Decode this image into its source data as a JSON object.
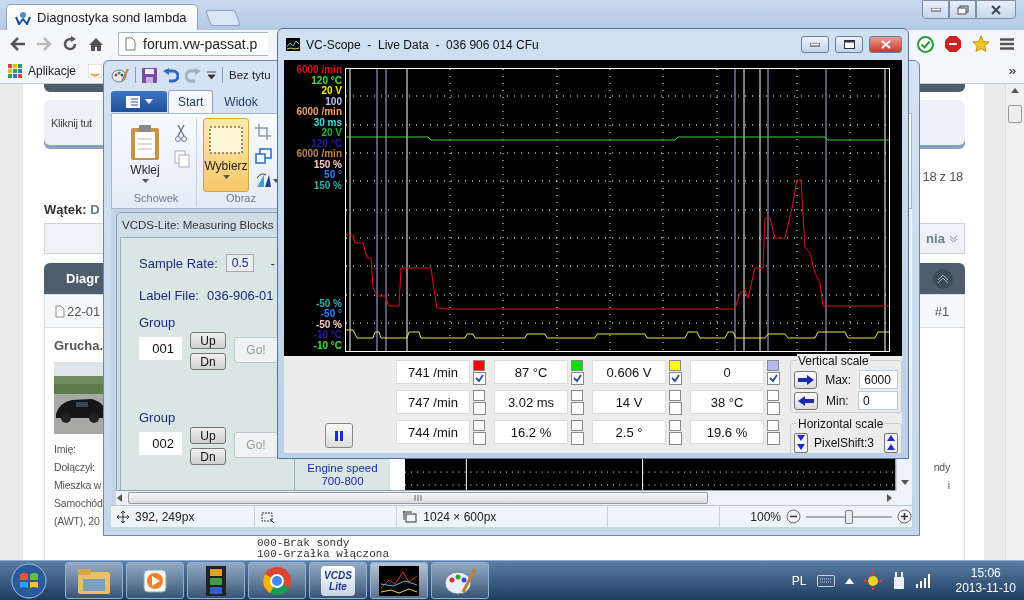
{
  "browser": {
    "tab_title": "Diagnostyka sond lambda",
    "url": "forum.vw-passat.p",
    "bookmarks": [
      "Aplikacje"
    ],
    "bookmarks_more": "»"
  },
  "forum": {
    "notice": "Kliknij tut",
    "page_count": "18 z 18",
    "thread_label": "Wątek:",
    "thread_title": "D",
    "tools_menu": "nia",
    "post_title": "Diagr",
    "post_date": "22-01",
    "post_number": "#1",
    "author": "Grucha.",
    "profile_fields": [
      "Imię:",
      "Dołączył:",
      "Mieszka w",
      "Samochód",
      "(AWT), 20"
    ],
    "post_text": [
      "ndy",
      "i"
    ],
    "post_lines": [
      "000-Brak sondy",
      "100-Grzałka włączona"
    ]
  },
  "paint": {
    "title": "Bez tytu",
    "tabs": [
      {
        "label": "Start",
        "selected": true
      },
      {
        "label": "Widok",
        "selected": false
      }
    ],
    "tools": [
      {
        "label": "Wklej",
        "selected": false
      },
      {
        "label": "Wybierz",
        "selected": true
      }
    ],
    "groups": [
      "Schowek",
      "Obraz"
    ],
    "status": {
      "cursor": "392, 249px",
      "size": "1024 × 600px",
      "zoom": "100%"
    },
    "zoom_slider": {
      "level": 0.5
    },
    "image": {
      "title": "VCDS-Lite: Measuring Blocks",
      "sample_rate_label": "Sample Rate:",
      "sample_rate": "0.5",
      "separator": "-",
      "label_file_label": "Label File:",
      "label_file": "036-906-01",
      "groups": [
        {
          "label": "Group",
          "value": "001",
          "up": "Up",
          "down": "Dn",
          "go": "Go!"
        },
        {
          "label": "Group",
          "value": "002",
          "up": "Up",
          "down": "Dn",
          "go": "Go!"
        }
      ],
      "field_name": "Engine speed",
      "field_range": "700-800"
    }
  },
  "scope": {
    "title": "VC-Scope  -  Live Data  -  036 906 014 CFu",
    "axis_top": [
      {
        "text": "6000 /min",
        "color": "#e01010"
      },
      {
        "text": "120 °C",
        "color": "#40e040"
      },
      {
        "text": "20 V",
        "color": "#f0f000"
      },
      {
        "text": "100",
        "color": "#c0c0f8"
      },
      {
        "text": "6000 /min",
        "color": "#f0a060"
      },
      {
        "text": "30 ms",
        "color": "#40e0e0"
      },
      {
        "text": "20 V",
        "color": "#30b030"
      },
      {
        "text": "120 °C",
        "color": "#2020a0"
      },
      {
        "text": "6000 /min",
        "color": "#c08048"
      },
      {
        "text": "150 %",
        "color": "#ffc8c8"
      },
      {
        "text": "50 °",
        "color": "#3080ff"
      },
      {
        "text": "150 %",
        "color": "#30b0b0"
      }
    ],
    "axis_bottom": [
      {
        "text": "-50 %",
        "color": "#30b0b0"
      },
      {
        "text": "-50 °",
        "color": "#3080ff"
      },
      {
        "text": "-50 %",
        "color": "#ffc8c8"
      },
      {
        "text": "-10 °C",
        "color": "#2020a0"
      },
      {
        "text": "-10 °C",
        "color": "#40e040"
      }
    ],
    "rows": [
      {
        "cells": [
          {
            "value": "741 /min",
            "color": "#ff0000",
            "checked": true
          },
          {
            "value": "87 °C",
            "color": "#00e000",
            "checked": true
          },
          {
            "value": "0.606 V",
            "color": "#ffff00",
            "checked": true
          },
          {
            "value": "0",
            "color": "#b8b8f0",
            "checked": true
          }
        ]
      },
      {
        "cells": [
          {
            "value": "747 /min",
            "checked": false
          },
          {
            "value": "3.02 ms",
            "checked": false
          },
          {
            "value": "14 V",
            "checked": false
          },
          {
            "value": "38 °C",
            "checked": false
          }
        ]
      },
      {
        "cells": [
          {
            "value": "744 /min",
            "checked": false
          },
          {
            "value": "16.2 %",
            "checked": false
          },
          {
            "value": "2.5 °",
            "checked": false
          },
          {
            "value": "19.6 %",
            "checked": false
          }
        ]
      }
    ],
    "vertical_scale": {
      "title": "Vertical scale",
      "max_label": "Max:",
      "max": "6000",
      "min_label": "Min:",
      "min": "0"
    },
    "horizontal_scale": {
      "title": "Horizontal scale",
      "value": "PixelShift:3"
    }
  },
  "taskbar": {
    "app_logo": [
      "VCDS",
      "Lite"
    ],
    "language": "PL",
    "time": "15:06",
    "date": "2013-11-10"
  }
}
